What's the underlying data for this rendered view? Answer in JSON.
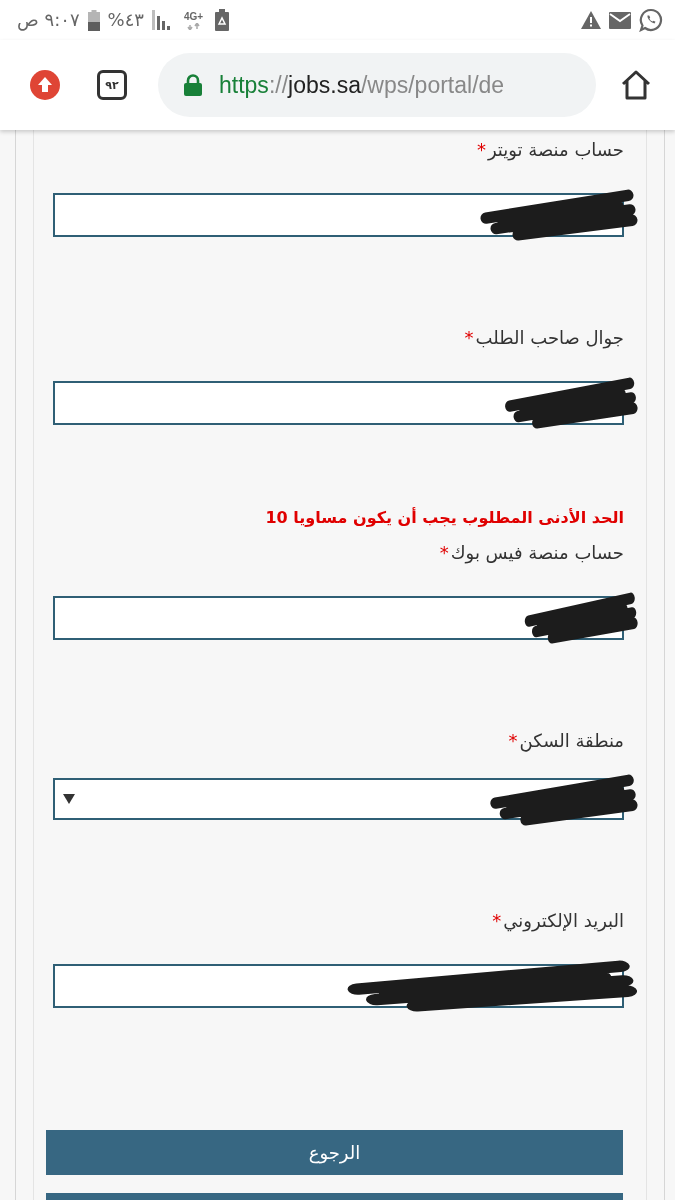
{
  "status_bar": {
    "time": "٩:٠٧ ص",
    "battery": "٤٣%",
    "network": "4G+"
  },
  "browser": {
    "tab_count": "٩٢",
    "url": {
      "scheme": "https",
      "separator": "://",
      "host": "jobs.sa",
      "path": "/wps/portal/de"
    }
  },
  "form": {
    "fields": [
      {
        "kind": "text",
        "label": "حساب منصة تويتر",
        "required_mark": "*",
        "redacted": true
      },
      {
        "kind": "text",
        "label": "جوال صاحب الطلب",
        "required_mark": "*",
        "redacted": true
      },
      {
        "kind": "text",
        "label": "حساب منصة فيس بوك",
        "required_mark": "*",
        "error": "الحد الأدنى المطلوب يجب أن يكون مساويا 10",
        "redacted": true
      },
      {
        "kind": "select",
        "label": "منطقة السكن",
        "required_mark": "*",
        "redacted": true
      },
      {
        "kind": "text",
        "label": "البريد الإلكتروني",
        "required_mark": "*",
        "redacted": true
      }
    ]
  },
  "buttons": [
    {
      "kind": "full",
      "label": "الرجوع"
    },
    {
      "kind": "cut"
    }
  ]
}
